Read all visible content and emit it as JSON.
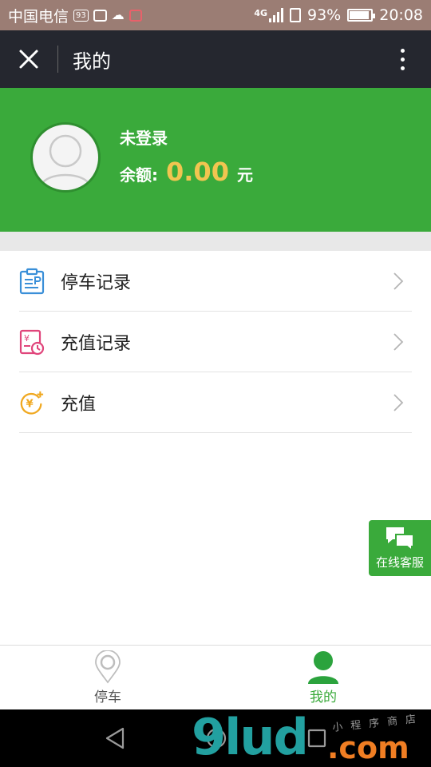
{
  "status_bar": {
    "carrier": "中国电信",
    "sim_badge": "93",
    "network": "4G",
    "battery_percent": "93%",
    "battery_level": 0.93,
    "time": "20:08"
  },
  "header": {
    "title": "我的",
    "close_icon": "close-icon",
    "more_icon": "more-vertical-icon"
  },
  "profile": {
    "login_status": "未登录",
    "balance_label": "余额:",
    "balance_value": "0.00",
    "balance_unit": "元"
  },
  "menu": {
    "items": [
      {
        "label": "停车记录",
        "icon": "parking-record-icon",
        "color": "#3a8fd8"
      },
      {
        "label": "充值记录",
        "icon": "recharge-record-icon",
        "color": "#e0457b"
      },
      {
        "label": "充值",
        "icon": "recharge-icon",
        "color": "#f0a820"
      }
    ]
  },
  "customer_service": {
    "label": "在线客服",
    "icon": "chat-bubbles-icon"
  },
  "tabbar": {
    "tabs": [
      {
        "label": "停车",
        "icon": "location-pin-icon",
        "active": false
      },
      {
        "label": "我的",
        "icon": "user-icon",
        "active": true
      }
    ]
  },
  "watermark": {
    "digits": "9lud",
    "com": ".com",
    "sub": "小程序商店"
  },
  "colors": {
    "header_bg": "#25272f",
    "accent_green": "#3aaa3b",
    "balance_yellow": "#f1c550"
  }
}
